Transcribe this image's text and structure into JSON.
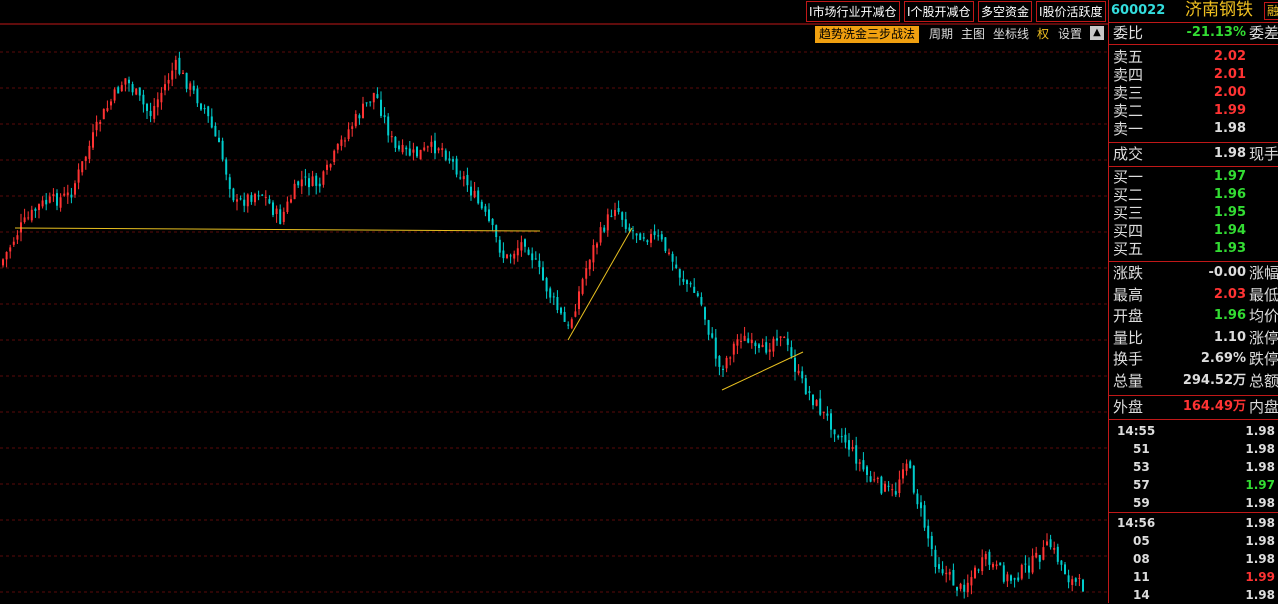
{
  "toolbar": {
    "btn1": "I市场行业开减仓",
    "btn2": "I个股开减仓",
    "btn3": "多空资金",
    "btn4": "I股价活跃度",
    "highlight": "趋势洗金三步战法",
    "period": "周期",
    "main_chart": "主图",
    "axis": "坐标线",
    "rights": "权",
    "settings": "设置",
    "scroll": "▲"
  },
  "stock": {
    "code": "600022",
    "name": "济南钢铁",
    "tag": "融"
  },
  "ratio": {
    "label": "委比",
    "value": "-21.13%",
    "extra": "委差"
  },
  "sells": [
    {
      "label": "卖五",
      "price": "2.02"
    },
    {
      "label": "卖四",
      "price": "2.01"
    },
    {
      "label": "卖三",
      "price": "2.00"
    },
    {
      "label": "卖二",
      "price": "1.99"
    },
    {
      "label": "卖一",
      "price": "1.98"
    }
  ],
  "deal": {
    "label": "成交",
    "value": "1.98",
    "extra": "现手"
  },
  "buys": [
    {
      "label": "买一",
      "price": "1.97"
    },
    {
      "label": "买二",
      "price": "1.96"
    },
    {
      "label": "买三",
      "price": "1.95"
    },
    {
      "label": "买四",
      "price": "1.94"
    },
    {
      "label": "买五",
      "price": "1.93"
    }
  ],
  "stats": [
    {
      "label": "涨跌",
      "value": "-0.00",
      "extra": "涨幅"
    },
    {
      "label": "最高",
      "value": "2.03",
      "extra": "最低"
    },
    {
      "label": "开盘",
      "value": "1.96",
      "extra": "均价"
    },
    {
      "label": "量比",
      "value": "1.10",
      "extra": "涨停"
    },
    {
      "label": "换手",
      "value": "2.69%",
      "extra": "跌停"
    },
    {
      "label": "总量",
      "value": "294.52万",
      "extra": "总额"
    }
  ],
  "outer": {
    "label": "外盘",
    "value": "164.49万",
    "extra": "内盘"
  },
  "ticks": [
    {
      "time": "14:55",
      "price": "1.98",
      "color": "#dddddd"
    },
    {
      "time": "51",
      "price": "1.98",
      "color": "#dddddd"
    },
    {
      "time": "53",
      "price": "1.98",
      "color": "#dddddd"
    },
    {
      "time": "57",
      "price": "1.97",
      "color": "#33dd33"
    },
    {
      "time": "59",
      "price": "1.98",
      "color": "#dddddd"
    },
    {
      "time": "14:56",
      "price": "1.98",
      "color": "#dddddd"
    },
    {
      "time": "05",
      "price": "1.98",
      "color": "#dddddd"
    },
    {
      "time": "08",
      "price": "1.98",
      "color": "#dddddd"
    },
    {
      "time": "11",
      "price": "1.99",
      "color": "#ff3333"
    },
    {
      "time": "14",
      "price": "1.98",
      "color": "#dddddd"
    }
  ],
  "colors": {
    "up": "#ff3333",
    "down": "#00cccc",
    "trend": "#e8c020",
    "grid": "#5a0a0a",
    "border": "#c01818"
  }
}
